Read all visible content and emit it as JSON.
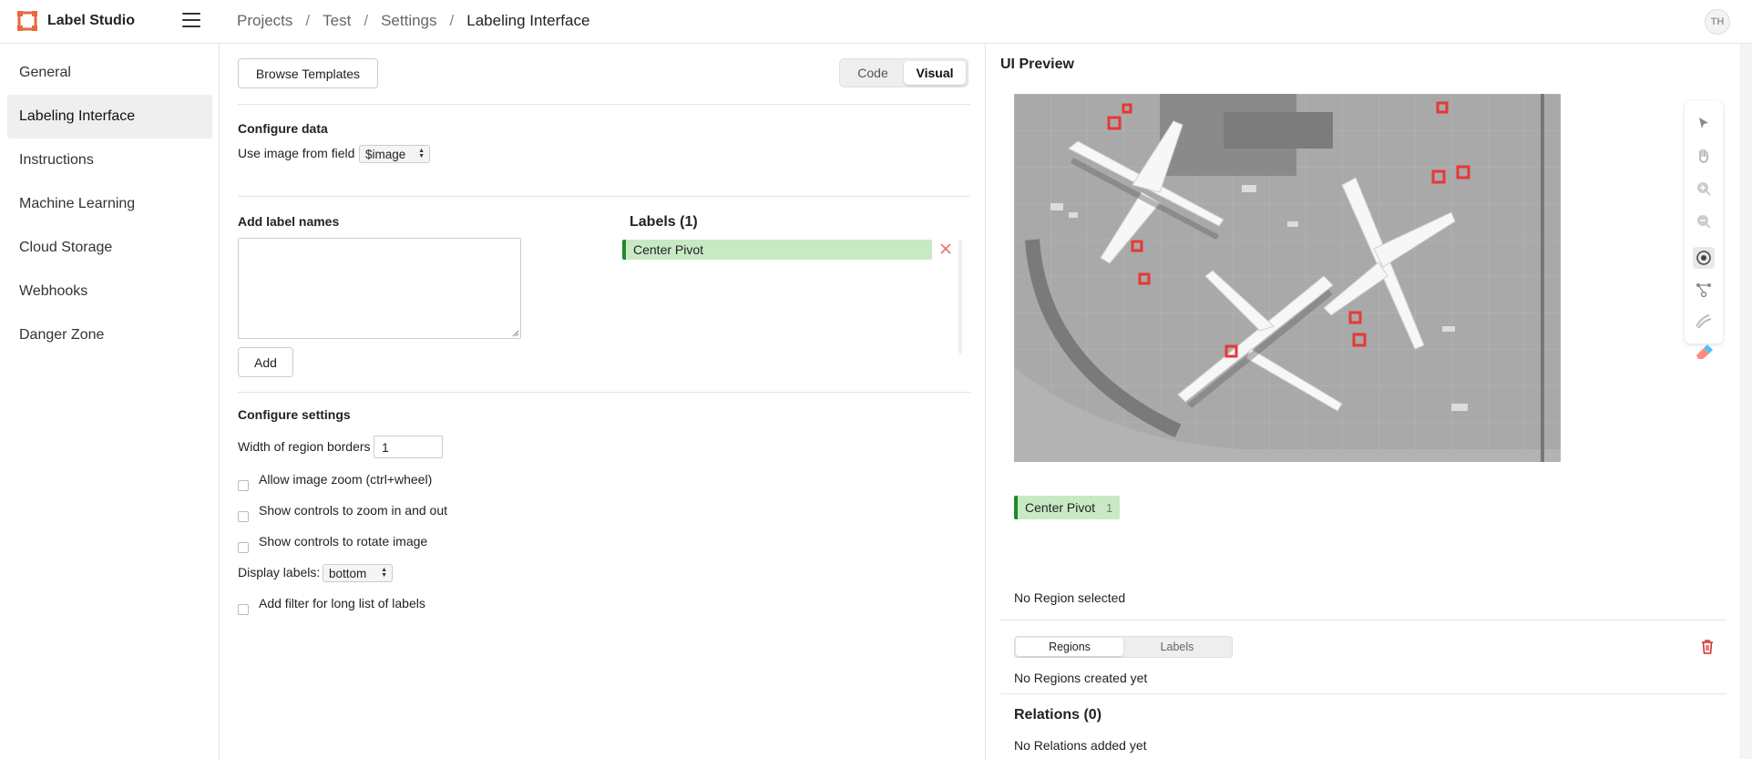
{
  "app": {
    "name": "Label Studio",
    "user_initials": "TH"
  },
  "breadcrumb": [
    "Projects",
    "Test",
    "Settings",
    "Labeling Interface"
  ],
  "breadcrumb_sep": "/",
  "sidebar": {
    "items": [
      {
        "label": "General",
        "active": false
      },
      {
        "label": "Labeling Interface",
        "active": true
      },
      {
        "label": "Instructions",
        "active": false
      },
      {
        "label": "Machine Learning",
        "active": false
      },
      {
        "label": "Cloud Storage",
        "active": false
      },
      {
        "label": "Webhooks",
        "active": false
      },
      {
        "label": "Danger Zone",
        "active": false
      }
    ]
  },
  "config": {
    "browse_templates": "Browse Templates",
    "mode_toggle": {
      "code": "Code",
      "visual": "Visual",
      "selected": "Visual"
    },
    "configure_data": {
      "heading": "Configure data",
      "field_label": "Use image from field",
      "field_value": "$image"
    },
    "add_labels": {
      "heading": "Add label names",
      "textarea_value": "",
      "add_button": "Add"
    },
    "labels": {
      "heading": "Labels (1)",
      "items": [
        {
          "name": "Center Pivot",
          "color": "#1f8a2a"
        }
      ]
    },
    "settings": {
      "heading": "Configure settings",
      "border_width_label": "Width of region borders",
      "border_width_value": "1",
      "allow_zoom": {
        "label": "Allow image zoom (ctrl+wheel)",
        "checked": false
      },
      "zoom_controls": {
        "label": "Show controls to zoom in and out",
        "checked": false
      },
      "rotate_controls": {
        "label": "Show controls to rotate image",
        "checked": false
      },
      "display_labels_label": "Display labels:",
      "display_labels_value": "bottom",
      "filter": {
        "label": "Add filter for long list of labels",
        "checked": false
      }
    }
  },
  "preview": {
    "title": "UI Preview",
    "tools": [
      "pointer-icon",
      "hand-icon",
      "zoom-in-icon",
      "zoom-out-icon",
      "brush-point-icon",
      "keypoint-icon",
      "polygon-brush-icon",
      "eraser-icon"
    ],
    "result_label": {
      "name": "Center Pivot",
      "count": "1"
    },
    "no_region": "No Region selected",
    "tabs": {
      "regions": "Regions",
      "labels": "Labels",
      "selected": "Regions"
    },
    "no_regions": "No Regions created yet",
    "relations_heading": "Relations (0)",
    "no_relations": "No Relations added yet"
  },
  "colors": {
    "label_green": "#1f8a2a",
    "label_bg": "#c8e9c4",
    "danger": "#d32f2f",
    "brand": "#e8683f"
  }
}
